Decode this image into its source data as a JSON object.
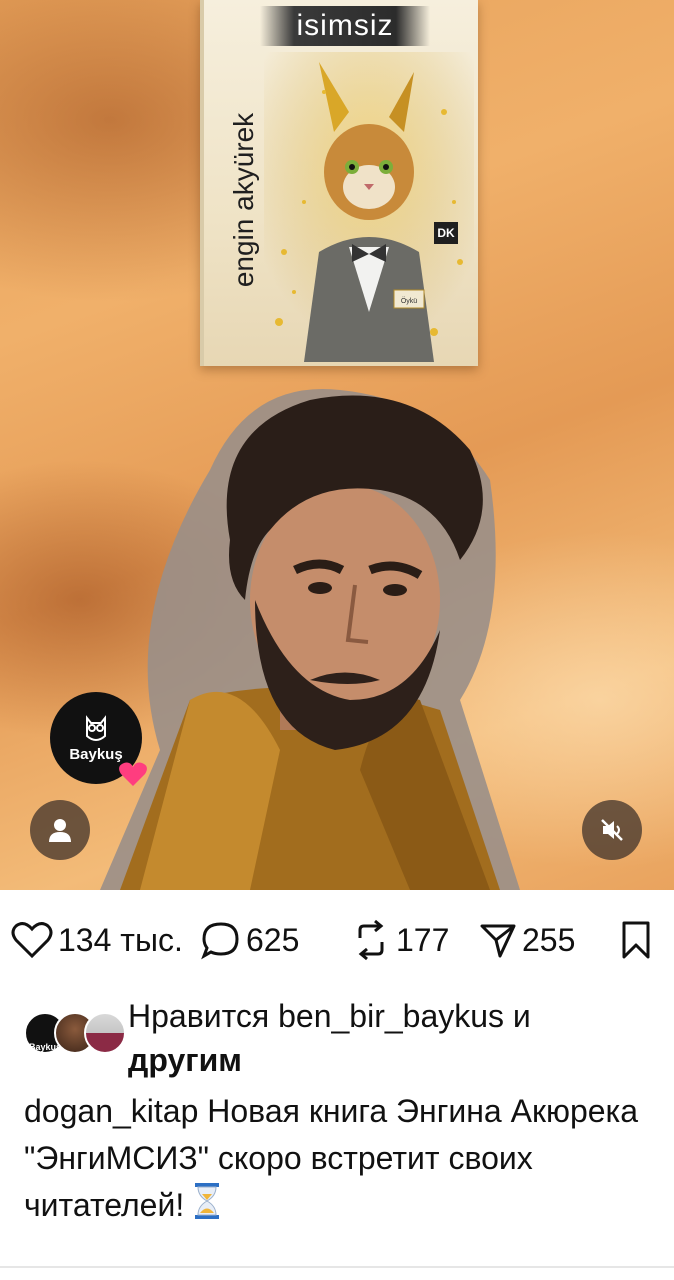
{
  "post": {
    "book_cover": {
      "title": "isimsiz",
      "author": "engin akyürek",
      "publisher_logo": "DK",
      "cover_badge_text": "Öykü"
    },
    "channel_badge": {
      "name": "Baykuş",
      "icon": "owl-icon"
    },
    "controls": {
      "profile": "user-icon",
      "mute": "speaker-muted-icon"
    },
    "stats": {
      "likes": "134 тыс.",
      "comments": "625",
      "reposts": "177",
      "shares": "255"
    },
    "liked_by": {
      "prefix": "Нравится ",
      "user": "ben_bir_baykus",
      "suffix": " и",
      "others": "другим",
      "avatar_label": "Baykuş"
    },
    "caption": {
      "author": "dogan_kitap",
      "text": "Новая книга Энгина Акюрека \"ЭнгиМСИЗ\" скоро встретит своих читателей!",
      "emoji": "hourglass-icon"
    }
  },
  "colors": {
    "background": "#ffffff",
    "text": "#111111",
    "heart_badge": "#ff3d7f",
    "overlay_button": "#4a3a30"
  }
}
